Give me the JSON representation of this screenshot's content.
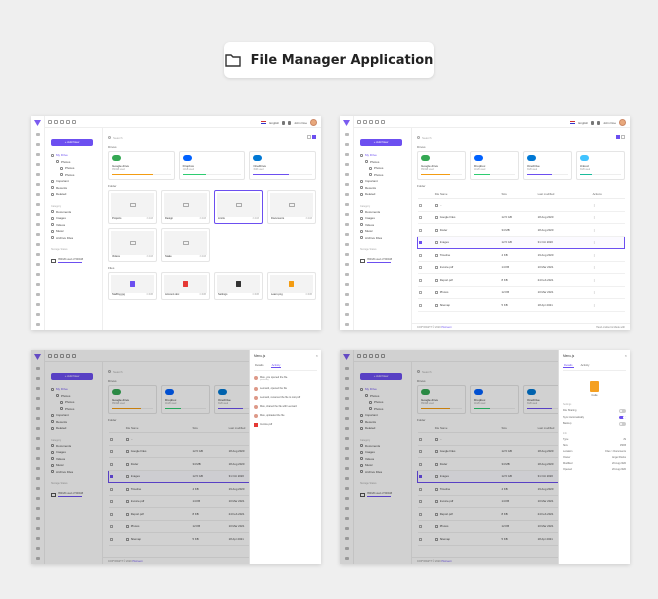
{
  "header": {
    "title": "File Manager Application"
  },
  "app": {
    "lang": "English",
    "user_name": "John Doe",
    "add_new": "+ Add New",
    "search_placeholder": "Search",
    "nav": {
      "my_drive": "My Drive",
      "photos": "Photos",
      "photos_sub1": "Photos",
      "photos_sub2": "Photos",
      "important": "Important",
      "recents": "Recents",
      "deleted": "Deleted",
      "category_label": "Category",
      "documents": "Documents",
      "images": "Images",
      "videos": "Videos",
      "music": "Music",
      "archive_files": "Archive Files",
      "storage_label": "Storage Status",
      "storage_used": "350GB used of 500GB"
    },
    "drives_label": "Drives",
    "folders_label": "Folder",
    "files_label": "Files",
    "drives": [
      {
        "name": "Google drive",
        "used": "350GB used",
        "color": "#f39c12",
        "fill": 0.7
      },
      {
        "name": "Dropbox",
        "used": "11GB used",
        "color": "#2ecc71",
        "fill": 0.4
      },
      {
        "name": "OneDrive",
        "used": "3GB used",
        "color": "#6c4ff0",
        "fill": 0.6
      },
      {
        "name": "iCloud",
        "used": "3GB used",
        "color": "#1abc9c",
        "fill": 0.3
      }
    ],
    "folders": [
      {
        "name": "Projects",
        "size": "3.4GB"
      },
      {
        "name": "Design",
        "size": "3.4GB"
      },
      {
        "name": "Limits",
        "size": "3.4GB"
      },
      {
        "name": "Documents",
        "size": "3.4GB"
      },
      {
        "name": "Videos",
        "size": "3.4GB"
      },
      {
        "name": "Stake",
        "size": "3.4GB"
      }
    ],
    "files": [
      {
        "name": "Staffing.jpg",
        "size": "3.4MB",
        "color": "#6c4ff0"
      },
      {
        "name": "Account.doc",
        "size": "3.4MB",
        "color": "#e53935"
      },
      {
        "name": "Settings",
        "size": "3.4MB",
        "color": "#333333"
      },
      {
        "name": "Learn.png",
        "size": "3.4MB",
        "color": "#f39c12"
      }
    ],
    "table": {
      "columns": [
        "File Name",
        "Size",
        "Last modified",
        "Actions"
      ],
      "rows": [
        {
          "name": "...",
          "size": "",
          "date": ""
        },
        {
          "name": "Google Files",
          "size": "12.5 GB",
          "date": "18 Aug 2020"
        },
        {
          "name": "Doder",
          "size": "34 MB",
          "date": "18 Aug 2020"
        },
        {
          "name": "Images",
          "size": "12.5 GB",
          "date": "31 Oct 2020"
        },
        {
          "name": "Timeline",
          "size": "4 KB",
          "date": "19 Aug 2020"
        },
        {
          "name": "Invoice.pdf",
          "size": "14 KB",
          "date": "10 Mar 2021"
        },
        {
          "name": "Report.pdf",
          "size": "8 KB",
          "date": "24 Feb 2021"
        },
        {
          "name": "Photos",
          "size": "12 KB",
          "date": "10 Mar 2021"
        },
        {
          "name": "Sitemap",
          "size": "5 KB",
          "date": "18 Apr 2021"
        }
      ]
    },
    "footer": {
      "copyright": "COPYRIGHT © 2020",
      "brand": "Pixinvent",
      "right": "Hand-crafted & Made with"
    },
    "drawer": {
      "title": "Menu.js",
      "tab_details": "Details",
      "tab_activity": "Activity",
      "activities": [
        {
          "text": "Max, you opened the file.",
          "when": "yesterday"
        },
        {
          "text": "Leonard, opened the file",
          "when": ""
        },
        {
          "text": "Leonard, renamed the file to List.pdf",
          "when": ""
        },
        {
          "text": "Max, shared the file with Leonard",
          "when": ""
        },
        {
          "text": "Max, uploaded the file",
          "when": ""
        }
      ],
      "upload_file": "Invoice.pdf",
      "file_name": "Code",
      "settings_label": "Settings",
      "file_sharing": "File Sharing",
      "sync": "Sync Automatically",
      "backup": "Backup",
      "info_label": "Info",
      "info": [
        {
          "k": "Type",
          "v": "JS"
        },
        {
          "k": "Size",
          "v": "15KB"
        },
        {
          "k": "Location",
          "v": "Files > Documents"
        },
        {
          "k": "Owner",
          "v": "Angel Rocks"
        },
        {
          "k": "Modified",
          "v": "20 Aug 2020"
        },
        {
          "k": "Opened",
          "v": "20 Aug 2020"
        }
      ]
    }
  }
}
